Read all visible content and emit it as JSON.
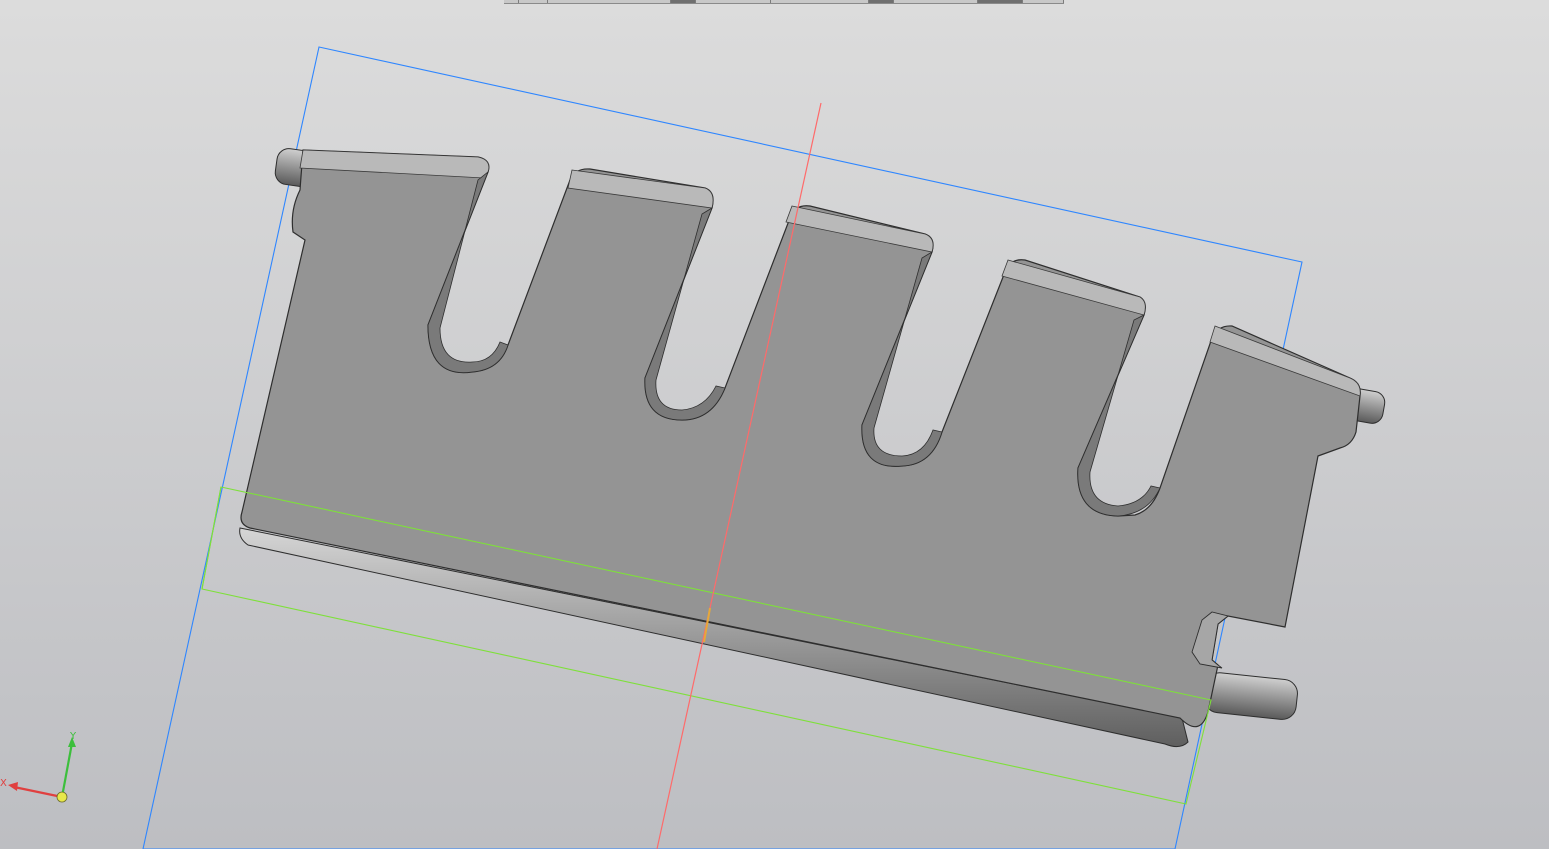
{
  "viewport": {
    "background_top": "#dcdcdc",
    "background_bottom": "#bdbec2"
  },
  "model": {
    "fill_color": "#949494",
    "edge_color": "#2e2e2e",
    "highlight_color": "#c9c9c9",
    "shadow_color": "#6a6a6a"
  },
  "construction_lines": {
    "plane_frame_color": "#2e86ff",
    "sketch_frame_color": "#7ee03a",
    "axis_line_color": "#ff6a6a"
  },
  "triad": {
    "x_label": "X",
    "y_label": "Y",
    "x_color": "#e04040",
    "y_color": "#3cbf3c",
    "origin_color": "#e8e84a",
    "icon": "coordinate-triad-icon"
  }
}
